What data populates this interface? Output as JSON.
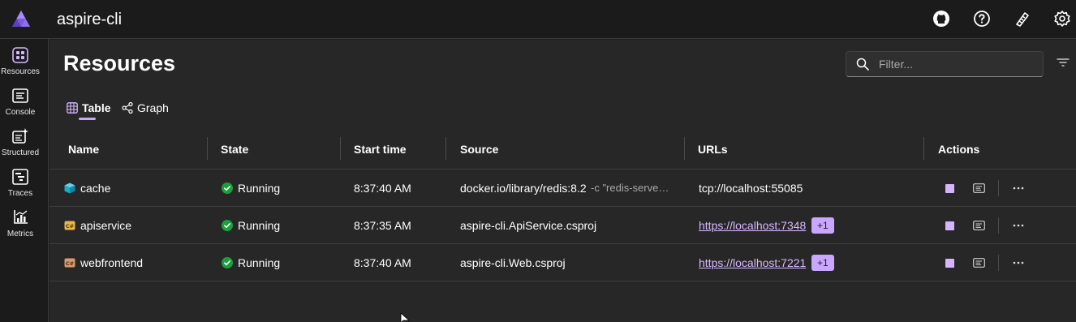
{
  "app": {
    "title": "aspire-cli"
  },
  "topbar": {
    "icons": [
      "github-icon",
      "help-icon",
      "feedback-icon",
      "settings-icon"
    ]
  },
  "nav": {
    "items": [
      {
        "label": "Resources",
        "icon": "resources-icon"
      },
      {
        "label": "Console",
        "icon": "console-icon"
      },
      {
        "label": "Structured",
        "icon": "structured-icon"
      },
      {
        "label": "Traces",
        "icon": "traces-icon"
      },
      {
        "label": "Metrics",
        "icon": "metrics-icon"
      }
    ]
  },
  "page": {
    "title": "Resources"
  },
  "filter": {
    "placeholder": "Filter..."
  },
  "tabs": [
    {
      "label": "Table",
      "selected": true
    },
    {
      "label": "Graph",
      "selected": false
    }
  ],
  "table": {
    "columns": [
      "Name",
      "State",
      "Start time",
      "Source",
      "URLs",
      "Actions"
    ],
    "rows": [
      {
        "name": "cache",
        "icon": "container-icon",
        "state": "Running",
        "start_time": "8:37:40 AM",
        "source": "docker.io/library/redis:8.2",
        "source_args": "-c \"redis-serve…",
        "url": "tcp://localhost:55085",
        "url_is_link": false,
        "extra_urls": ""
      },
      {
        "name": "apiservice",
        "icon": "project-icon",
        "state": "Running",
        "start_time": "8:37:35 AM",
        "source": "aspire-cli.ApiService.csproj",
        "source_args": "",
        "url": "https://localhost:7348",
        "url_is_link": true,
        "extra_urls": "+1"
      },
      {
        "name": "webfrontend",
        "icon": "project-icon",
        "state": "Running",
        "start_time": "8:37:40 AM",
        "source": "aspire-cli.Web.csproj",
        "source_args": "",
        "url": "https://localhost:7221",
        "url_is_link": true,
        "extra_urls": "+1"
      }
    ]
  },
  "colors": {
    "accent": "#c9a6ff",
    "running": "#1c9f3c",
    "background": "#272727",
    "chrome": "#1b1b1b"
  }
}
